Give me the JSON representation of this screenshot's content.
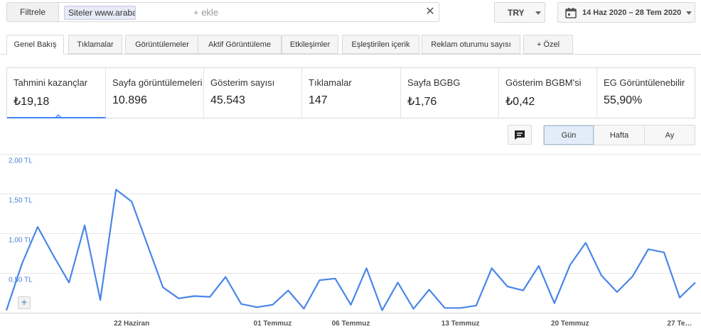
{
  "filter": {
    "button_label": "Filtrele",
    "chip_label": "Siteler www.araba",
    "add_placeholder": "+ ekle",
    "clear_symbol": "✕"
  },
  "currency": {
    "value": "TRY"
  },
  "date_range": {
    "value": "14 Haz 2020 – 28 Tem 2020",
    "icon": "calendar-icon"
  },
  "tabs": [
    {
      "label": "Genel Bakış",
      "active": true
    },
    {
      "label": "Tıklamalar"
    },
    {
      "label": "Görüntülemeler"
    },
    {
      "label": "Aktif Görüntüleme"
    },
    {
      "label": "Etkileşimler"
    },
    {
      "label": "Eşleştirilen içerik"
    },
    {
      "label": "Reklam oturumu sayısı"
    },
    {
      "label": "+  Özel"
    }
  ],
  "metrics": [
    {
      "label": "Tahmini kazançlar",
      "value": "₺19,18",
      "active": true
    },
    {
      "label": "Sayfa görüntülemeleri",
      "value": "10.896"
    },
    {
      "label": "Gösterim sayısı",
      "value": "45.543"
    },
    {
      "label": "Tıklamalar",
      "value": "147"
    },
    {
      "label": "Sayfa BGBG",
      "value": "₺1,76"
    },
    {
      "label": "Gösterim BGBM'si",
      "value": "₺0,42"
    },
    {
      "label": "EG Görüntülenebilir",
      "value": "55,90%"
    }
  ],
  "comment_icon": "comment-icon",
  "granularity": {
    "options": [
      "Gün",
      "Hafta",
      "Ay"
    ],
    "selected": "Gün"
  },
  "zoom_icon": "zoom-plus-icon",
  "colors": {
    "accent": "#4285f4",
    "line": "#4a86e8"
  },
  "chart_data": {
    "type": "line",
    "title": "",
    "xlabel": "",
    "ylabel": "",
    "ylim": [
      0,
      2.0
    ],
    "y_ticks": [
      "2,00 TL",
      "1,50 TL",
      "1,00 TL",
      "0,50 TL"
    ],
    "y_tick_values": [
      2.0,
      1.5,
      1.0,
      0.5
    ],
    "x_tick_labels": [
      {
        "label": "22 Haziran",
        "index": 8
      },
      {
        "label": "01 Temmuz",
        "index": 17
      },
      {
        "label": "06 Temmuz",
        "index": 22
      },
      {
        "label": "13 Temmuz",
        "index": 29
      },
      {
        "label": "20 Temmuz",
        "index": 36
      },
      {
        "label": "27 Te…",
        "index": 43
      }
    ],
    "grid": true,
    "series": [
      {
        "values": [
          0.03,
          0.62,
          1.08,
          0.72,
          0.38,
          1.1,
          0.16,
          1.55,
          1.4,
          0.86,
          0.32,
          0.18,
          0.21,
          0.2,
          0.45,
          0.11,
          0.07,
          0.1,
          0.28,
          0.05,
          0.41,
          0.43,
          0.1,
          0.56,
          0.03,
          0.38,
          0.05,
          0.29,
          0.06,
          0.06,
          0.09,
          0.56,
          0.33,
          0.28,
          0.59,
          0.12,
          0.6,
          0.88,
          0.47,
          0.26,
          0.46,
          0.8,
          0.76,
          0.19,
          0.38
        ]
      }
    ]
  }
}
